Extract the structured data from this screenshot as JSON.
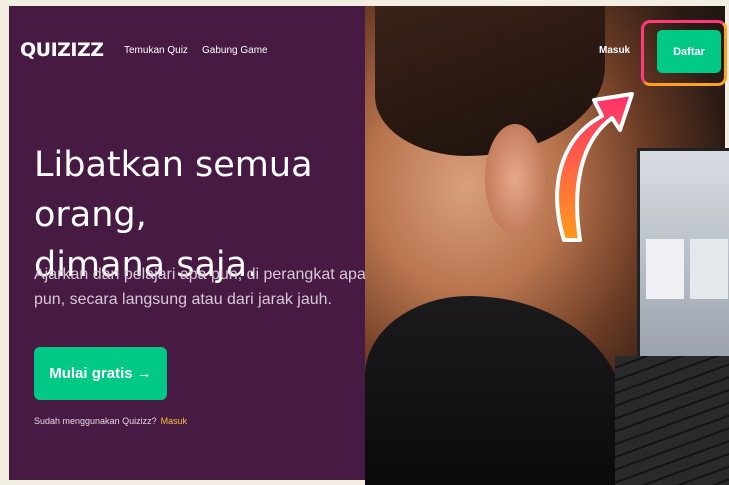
{
  "header": {
    "logo": "QUIZIZZ",
    "nav": [
      "Temukan Quiz",
      "Gabung Game"
    ],
    "login": "Masuk",
    "signup": "Daftar"
  },
  "hero": {
    "headline_line1": "Libatkan semua orang,",
    "headline_line2": "dimana saja.",
    "subtitle": "Ajarkan dan pelajari apa pun, di perangkat apa pun, secara langsung atau dari jarak jauh.",
    "cta": "Mulai gratis →",
    "already_text": "Sudah menggunakan Quizizz?",
    "already_link": "Masuk"
  },
  "colors": {
    "background_panel": "#461a42",
    "accent_green": "#00c985",
    "highlight_pink": "#ff3a7a",
    "highlight_orange": "#ffa11e",
    "link_yellow": "#ffbf3a"
  },
  "icons": [
    "curved-arrow-icon",
    "right-arrow-icon"
  ]
}
